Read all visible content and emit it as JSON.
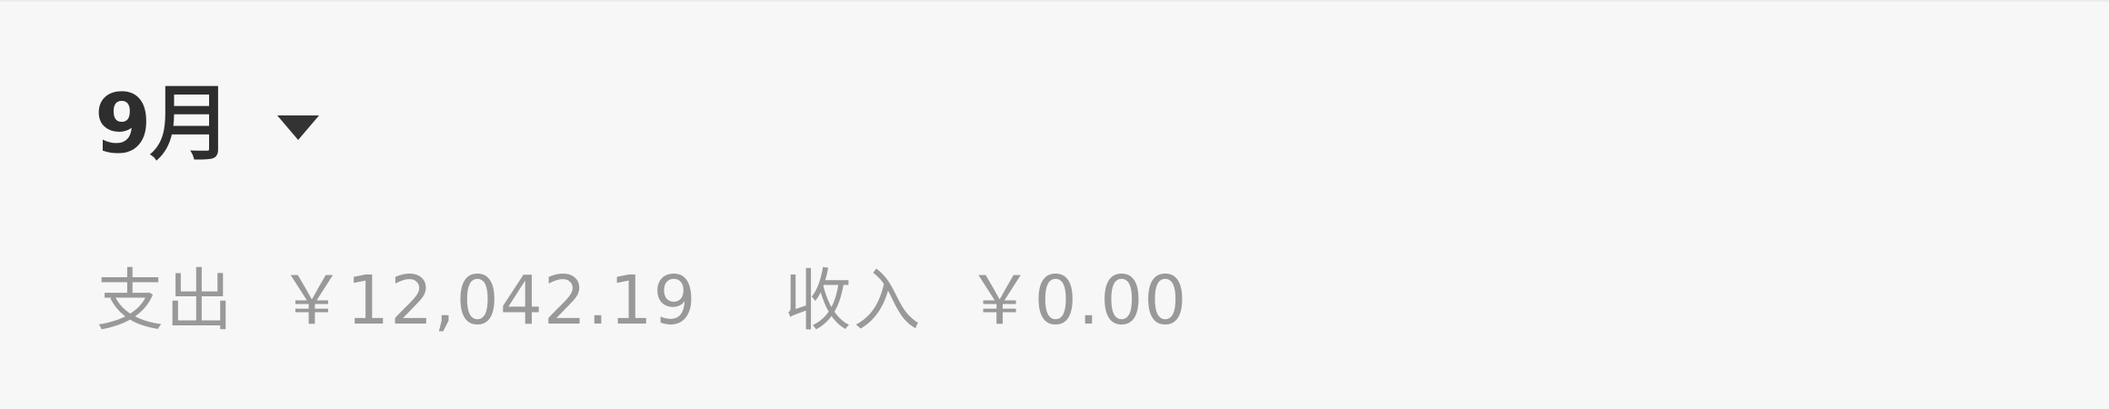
{
  "header": {
    "month_label": "9月",
    "dropdown_icon": "caret-down-icon"
  },
  "summary": {
    "expense_label": "支出",
    "expense_amount": "￥12,042.19",
    "income_label": "收入",
    "income_amount": "￥0.00"
  }
}
